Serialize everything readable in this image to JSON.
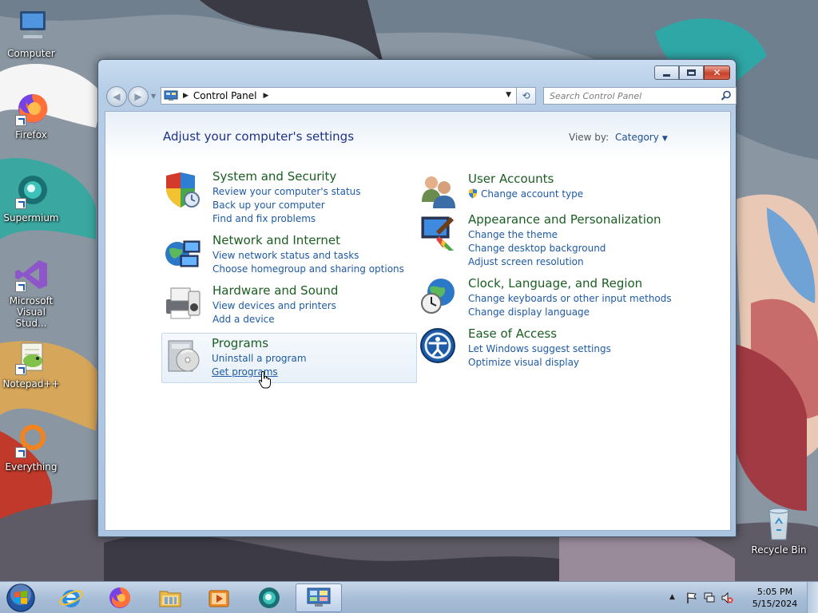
{
  "desktop": {
    "icons": [
      {
        "label": "Computer",
        "icon": "computer-icon"
      },
      {
        "label": "Firefox",
        "icon": "firefox-icon"
      },
      {
        "label": "Supermium",
        "icon": "supermium-icon"
      },
      {
        "label": "Microsoft Visual Stud...",
        "icon": "visual-studio-icon"
      },
      {
        "label": "Notepad++",
        "icon": "notepad-plus-plus-icon"
      },
      {
        "label": "Everything",
        "icon": "everything-search-icon"
      },
      {
        "label": "Recycle Bin",
        "icon": "recycle-bin-icon"
      }
    ]
  },
  "window": {
    "address": {
      "crumb": "Control Panel"
    },
    "search": {
      "placeholder": "Search Control Panel"
    },
    "heading": "Adjust your computer's settings",
    "view_by": {
      "label": "View by:",
      "value": "Category"
    },
    "categories": [
      {
        "title": "System and Security",
        "icon": "system-security-icon",
        "links": [
          "Review your computer's status",
          "Back up your computer",
          "Find and fix problems"
        ]
      },
      {
        "title": "Network and Internet",
        "icon": "network-internet-icon",
        "links": [
          "View network status and tasks",
          "Choose homegroup and sharing options"
        ]
      },
      {
        "title": "Hardware and Sound",
        "icon": "hardware-sound-icon",
        "links": [
          "View devices and printers",
          "Add a device"
        ]
      },
      {
        "title": "Programs",
        "icon": "programs-icon",
        "links": [
          "Uninstall a program",
          "Get programs"
        ]
      },
      {
        "title": "User Accounts",
        "icon": "user-accounts-icon",
        "links": [
          "Change account type"
        ]
      },
      {
        "title": "Appearance and Personalization",
        "icon": "appearance-icon",
        "links": [
          "Change the theme",
          "Change desktop background",
          "Adjust screen resolution"
        ]
      },
      {
        "title": "Clock, Language, and Region",
        "icon": "clock-region-icon",
        "links": [
          "Change keyboards or other input methods",
          "Change display language"
        ]
      },
      {
        "title": "Ease of Access",
        "icon": "ease-of-access-icon",
        "links": [
          "Let Windows suggest settings",
          "Optimize visual display"
        ]
      }
    ]
  },
  "taskbar": {
    "apps": [
      "internet-explorer-icon",
      "firefox-icon",
      "file-explorer-icon",
      "media-player-icon",
      "supermium-icon",
      "control-panel-icon"
    ],
    "clock": {
      "time": "5:05 PM",
      "date": "5/15/2024"
    }
  }
}
